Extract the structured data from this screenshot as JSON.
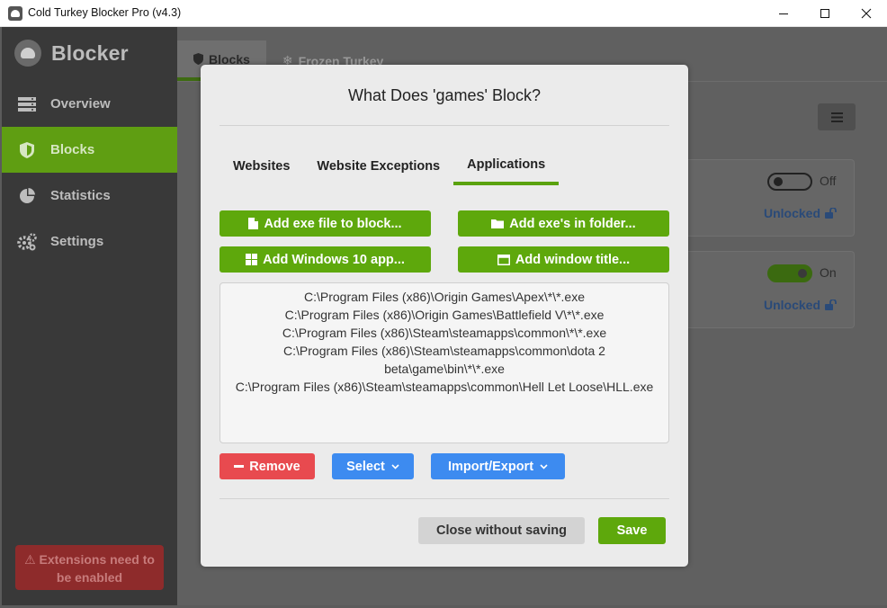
{
  "window": {
    "title": "Cold Turkey Blocker Pro (v4.3)"
  },
  "sidebar": {
    "brand": "Blocker",
    "items": [
      {
        "label": "Overview",
        "icon": "server-icon"
      },
      {
        "label": "Blocks",
        "icon": "shield-icon"
      },
      {
        "label": "Statistics",
        "icon": "pie-chart-icon"
      },
      {
        "label": "Settings",
        "icon": "gears-icon"
      }
    ],
    "active": "Blocks",
    "warning": "Extensions need to be enabled"
  },
  "main": {
    "tabs": [
      {
        "label": "Blocks",
        "icon": "shield-icon"
      },
      {
        "label": "Frozen Turkey",
        "icon": "snowflake-icon"
      }
    ],
    "cards": [
      {
        "toggle": "Off",
        "status": "Unlocked"
      },
      {
        "toggle": "On",
        "status": "Unlocked"
      }
    ]
  },
  "dialog": {
    "title": "What Does 'games' Block?",
    "tabs": [
      "Websites",
      "Website Exceptions",
      "Applications"
    ],
    "active_tab": "Applications",
    "buttons": {
      "add_exe": "Add exe file to block...",
      "add_folder": "Add exe's in folder...",
      "add_win10": "Add Windows 10 app...",
      "add_title": "Add window title..."
    },
    "list": [
      "C:\\Program Files (x86)\\Origin Games\\Apex\\*\\*.exe",
      "C:\\Program Files (x86)\\Origin Games\\Battlefield V\\*\\*.exe",
      "C:\\Program Files (x86)\\Steam\\steamapps\\common\\*\\*.exe",
      "C:\\Program Files (x86)\\Steam\\steamapps\\common\\dota 2",
      "beta\\game\\bin\\*\\*.exe",
      "C:\\Program Files (x86)\\Steam\\steamapps\\common\\Hell Let Loose\\HLL.exe"
    ],
    "remove": "Remove",
    "select": "Select",
    "import_export": "Import/Export",
    "close_without_saving": "Close without saving",
    "save": "Save"
  },
  "colors": {
    "green": "#5ea80c",
    "red": "#e84a4f",
    "blue": "#3d8bf0"
  }
}
